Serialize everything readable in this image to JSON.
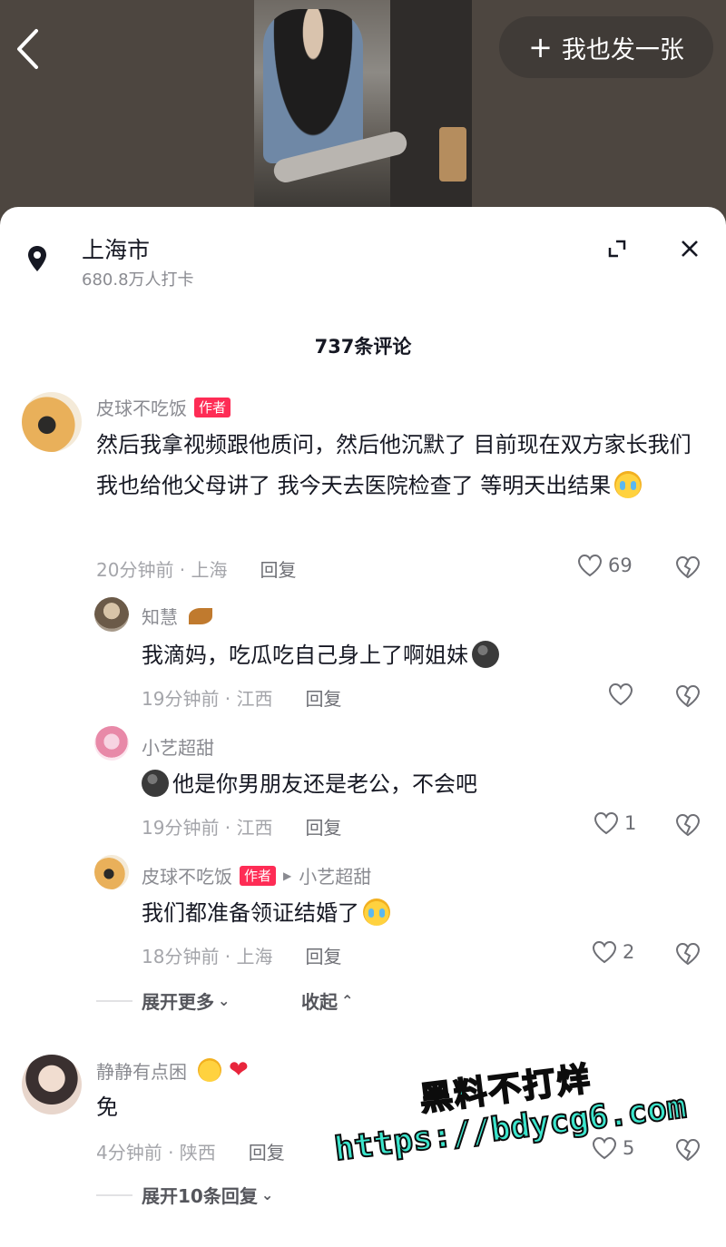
{
  "header": {
    "post_button_label": "我也发一张",
    "post_button_icon": "plus-icon",
    "back_icon": "chevron-left-icon"
  },
  "location": {
    "title": "上海市",
    "subtitle": "680.8万人打卡"
  },
  "comment_count": "737条评论",
  "comments": [
    {
      "user": "皮球不吃饭",
      "author_tag": "作者",
      "text": "然后我拿视频跟他质问，然后他沉默了 目前现在双方家长我们我也给他父母讲了 我今天去医院检查了 等明天出结果",
      "time": "20分钟前 · 上海",
      "reply_label": "回复",
      "likes": "69"
    },
    {
      "user": "知慧",
      "text": "我滴妈，吃瓜吃自己身上了啊姐妹",
      "time": "19分钟前 · 江西",
      "reply_label": "回复",
      "likes": ""
    },
    {
      "user": "小艺超甜",
      "text": "他是你男朋友还是老公，不会吧",
      "time": "19分钟前 · 江西",
      "reply_label": "回复",
      "likes": "1"
    },
    {
      "user": "皮球不吃饭",
      "author_tag": "作者",
      "reply_to": "小艺超甜",
      "text": "我们都准备领证结婚了",
      "time": "18分钟前 · 上海",
      "reply_label": "回复",
      "likes": "2"
    },
    {
      "user": "静静有点困",
      "text": "免",
      "time": "4分钟前 · 陕西",
      "reply_label": "回复",
      "likes": "5"
    }
  ],
  "thread_controls": {
    "expand_more": "展开更多",
    "collapse": "收起",
    "expand_replies": "展开10条回复"
  },
  "watermark": {
    "line1": "黑料不打烊",
    "line2": "https://bdycg6.com"
  },
  "colors": {
    "author_tag": "#fe2c55",
    "watermark": "#3be5cc"
  }
}
